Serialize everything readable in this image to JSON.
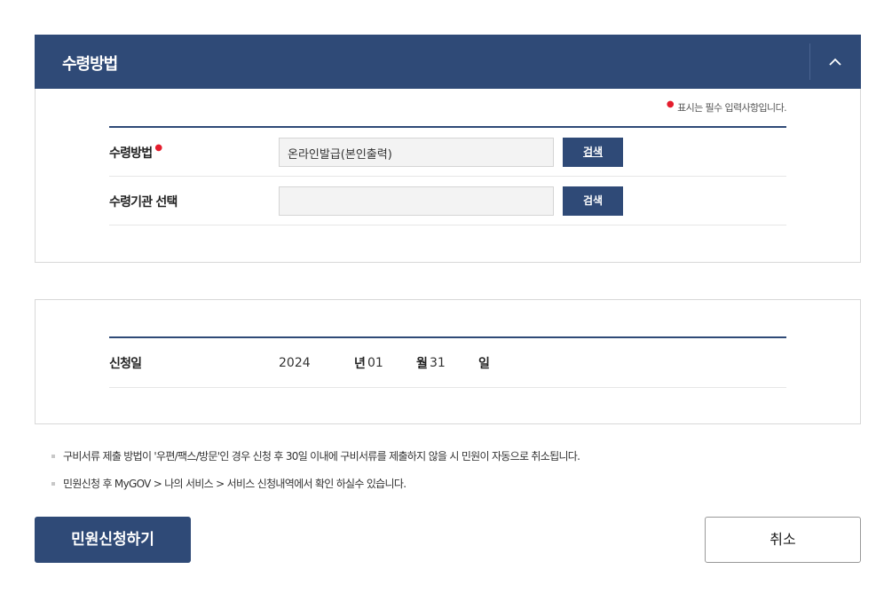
{
  "receipt_section": {
    "title": "수령방법",
    "toggle_icon": "chevron-up-icon",
    "required_note": "표시는 필수 입력사항입니다.",
    "rows": [
      {
        "label": "수령방법",
        "required": true,
        "value": "온라인발급(본인출력)",
        "button": "검색"
      },
      {
        "label": "수령기관 선택",
        "required": false,
        "value": "",
        "button": "검색"
      }
    ]
  },
  "date_section": {
    "label": "신청일",
    "year": "2024",
    "year_unit": "년",
    "month": "01",
    "month_unit": "월",
    "day": "31",
    "day_unit": "일"
  },
  "notes": [
    "구비서류 제출 방법이 '우편/팩스/방문'인 경우 신청 후 30일 이내에 구비서류를 제출하지 않을 시 민원이 자동으로 취소됩니다.",
    "민원신청 후 MyGOV > 나의 서비스 > 서비스 신청내역에서 확인 하실수 있습니다."
  ],
  "actions": {
    "submit": "민원신청하기",
    "cancel": "취소"
  },
  "colors": {
    "primary": "#2f4a77",
    "required": "#e41d2d"
  }
}
